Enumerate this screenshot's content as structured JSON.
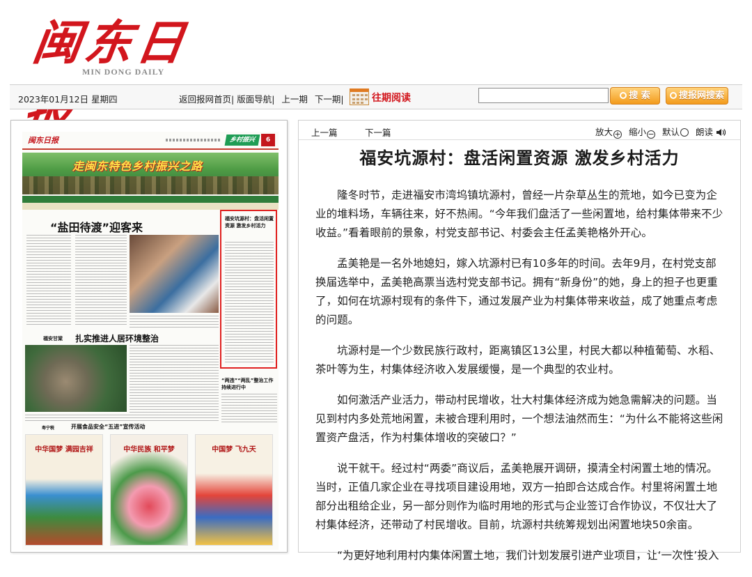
{
  "masthead": {
    "logo_text": "闽东日报",
    "logo_sub": "MIN DONG DAILY"
  },
  "toolbar": {
    "date": "2023年01月12日 星期四",
    "links": [
      "返回报网首页|",
      "版面导航|",
      "上一期",
      "下一期|"
    ],
    "archive_label": "往期阅读",
    "search_placeholder": "",
    "search_button": "搜 索",
    "network_search_button": "搜报网搜索"
  },
  "thumbnail": {
    "paper_logo": "闽东日报",
    "section": "乡村振兴",
    "page_num": "6",
    "banner_title": "走闽东特色乡村振兴之路",
    "headline_1": "“盐田待渡”迎客来",
    "headline_2": "扎实推进人居环境整治",
    "headline_2_kicker": "福安甘棠",
    "headline_3": "开展食品安全“五进”宣传活动",
    "headline_3_kicker": "寿宁税",
    "highlight_title": "福安坑源村：盘活闲置资源 激发乡村活力",
    "side_title": "“两违”“两乱”整治工作持续进行中",
    "posters": [
      "中华国梦 满园吉祥",
      "中华民族 和平梦",
      "中国梦 飞九天"
    ]
  },
  "article": {
    "nav": {
      "prev": "上一篇",
      "next": "下一篇"
    },
    "tools": {
      "zoom_in": "放大",
      "zoom_out": "缩小",
      "default": "默认",
      "read_aloud": "朗读"
    },
    "title": "福安坑源村：盘活闲置资源  激发乡村活力",
    "paragraphs": [
      "隆冬时节，走进福安市湾坞镇坑源村，曾经一片杂草丛生的荒地，如今已变为企业的堆料场，车辆往来，好不热闹。“今年我们盘活了一些闲置地，给村集体带来不少收益。”看着眼前的景象，村党支部书记、村委会主任孟美艳格外开心。",
      "孟美艳是一名外地媳妇，嫁入坑源村已有10多年的时间。去年9月，在村党支部换届选举中，孟美艳高票当选村党支部书记。拥有“新身份”的她，身上的担子也更重了，如何在坑源村现有的条件下，通过发展产业为村集体带来收益，成了她重点考虑的问题。",
      "坑源村是一个少数民族行政村，距离镇区13公里，村民大都以种植葡萄、水稻、茶叶等为生，村集体经济收入发展缓慢，是一个典型的农业村。",
      "如何激活产业活力，带动村民增收，壮大村集体经济成为她急需解决的问题。当见到村内多处荒地闲置，未被合理利用时，一个想法油然而生：“为什么不能将这些闲置资产盘活，作为村集体增收的突破口？”",
      "说干就干。经过村“两委”商议后，孟美艳展开调研，摸清全村闲置土地的情况。当时，正值几家企业在寻找项目建设用地，双方一拍即合达成合作。村里将闲置土地部分出租给企业，另一部分则作为临时用地的形式与企业签订合作协议，不仅壮大了村集体经济，还带动了村民增收。目前，坑源村共统筹规划出闲置地块50余亩。",
      "“为更好地利用村内集体闲置土地，我们计划发展引进产业项目，让‘一次性’投入"
    ]
  },
  "colors": {
    "brand_red": "#d2161d",
    "accent_orange": "#f39b1c",
    "highlight_red": "#e0201f"
  }
}
